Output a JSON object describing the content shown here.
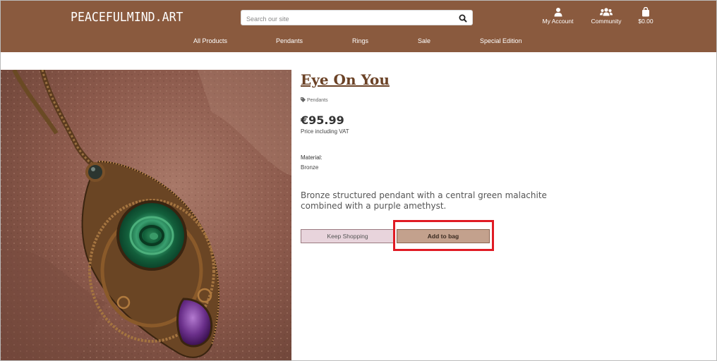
{
  "header": {
    "logo": "PEACEFULMIND.ART",
    "search": {
      "placeholder": "Search our site",
      "value": ""
    },
    "actions": {
      "account": "My Account",
      "community": "Community",
      "bag": "$0.00"
    }
  },
  "nav": {
    "items": [
      "All Products",
      "Pendants",
      "Rings",
      "Sale",
      "Special Edition"
    ]
  },
  "product": {
    "title": "Eye On You",
    "category": "Pendants",
    "price": "€95.99",
    "price_note": "Price including VAT",
    "material_label": "Material:",
    "material_value": "Bronze",
    "description": "Bronze structured pendant with a central green malachite combined with a purple amethyst.",
    "buttons": {
      "keep_shopping": "Keep Shopping",
      "add_to_bag": "Add to bag"
    }
  },
  "colors": {
    "header_bg": "#8a5a3e",
    "accent_title": "#6b4226",
    "keep_btn_bg": "#e8d4dc",
    "add_btn_bg": "#c3a18d",
    "highlight": "#e01b24"
  },
  "icons": {
    "search": "search-icon",
    "account": "user-icon",
    "community": "users-icon",
    "bag": "shopping-bag-icon",
    "category": "tag-icon"
  }
}
